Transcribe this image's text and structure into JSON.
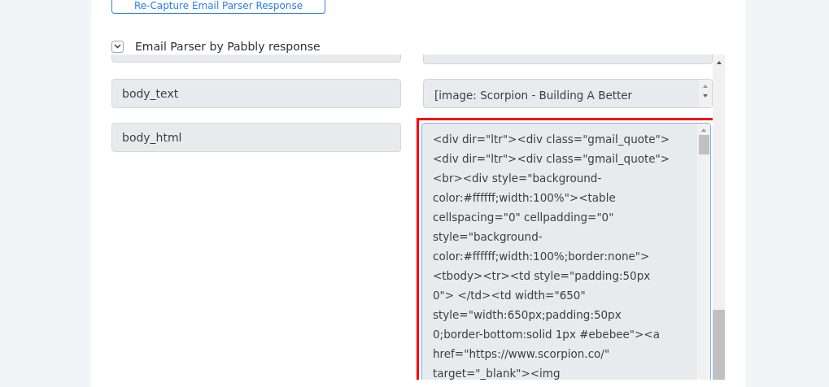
{
  "recapture_button": {
    "label": "Re-Capture Email Parser Response"
  },
  "section": {
    "title": "Email Parser by Pabbly response",
    "expanded": true
  },
  "fields": [
    {
      "kind": "partial"
    },
    {
      "kind": "short",
      "name": "body_text",
      "value_lines": [
        "[image: Scorpion - Building A Better"
      ]
    },
    {
      "kind": "tall",
      "name": "body_html",
      "highlighted": true,
      "value_lines": [
        "<div dir=\"ltr\"><div class=\"gmail_quote\">",
        "<div dir=\"ltr\"><div class=\"gmail_quote\">",
        "<br><div style=\"background-",
        "color:#ffffff;width:100%\"><table",
        "cellspacing=\"0\" cellpadding=\"0\"",
        "style=\"background-",
        "color:#ffffff;width:100%;border:none\">",
        "<tbody><tr><td style=\"padding:50px",
        "0\"> </td><td width=\"650\"",
        "style=\"width:650px;padding:50px",
        "0;border-bottom:solid 1px #ebebee\"><a",
        "href=\"https://www.scorpion.co/\"",
        "target=\"_blank\"><img"
      ]
    }
  ]
}
